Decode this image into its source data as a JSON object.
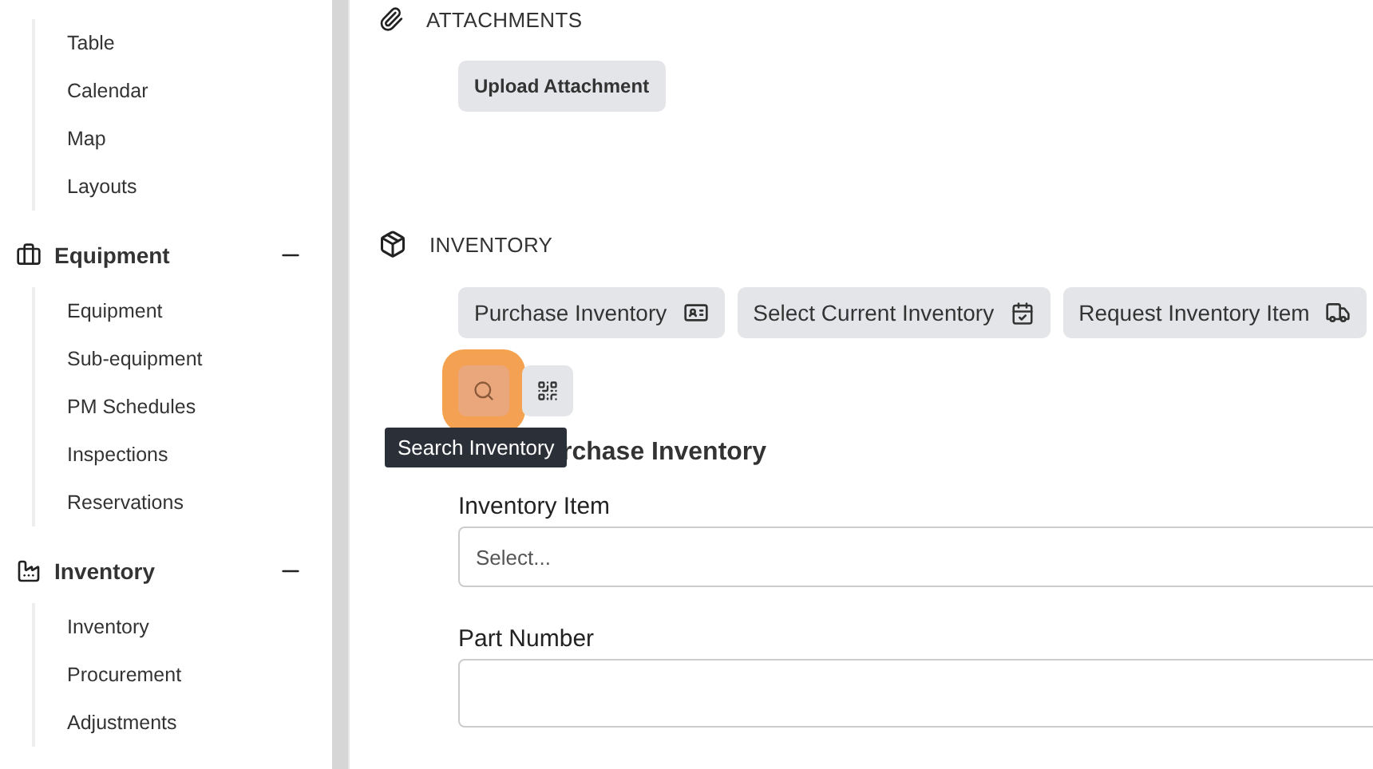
{
  "sidebar": {
    "sections": [
      {
        "items": [
          {
            "label": "Table"
          },
          {
            "label": "Calendar"
          },
          {
            "label": "Map"
          },
          {
            "label": "Layouts"
          }
        ]
      },
      {
        "title": "Equipment",
        "expanded": true,
        "items": [
          {
            "label": "Equipment"
          },
          {
            "label": "Sub-equipment"
          },
          {
            "label": "PM Schedules"
          },
          {
            "label": "Inspections"
          },
          {
            "label": "Reservations"
          }
        ]
      },
      {
        "title": "Inventory",
        "expanded": true,
        "items": [
          {
            "label": "Inventory"
          },
          {
            "label": "Procurement"
          },
          {
            "label": "Adjustments"
          }
        ]
      }
    ]
  },
  "attachments": {
    "title": "ATTACHMENTS",
    "buttons": [
      {
        "label": "Upload Attachment"
      }
    ]
  },
  "inventory": {
    "title": "INVENTORY",
    "buttons": [
      {
        "label": "Purchase Inventory",
        "kind": "card"
      },
      {
        "label": "Select Current Inventory",
        "kind": "calendar"
      },
      {
        "label": "Request Inventory Item",
        "kind": "truck"
      }
    ],
    "icon_buttons": [
      {
        "kind": "search",
        "selected": true
      },
      {
        "kind": "qr",
        "selected": false
      }
    ],
    "tooltip": "Search Inventory",
    "form": {
      "heading": "rchase Inventory",
      "fields": [
        {
          "label": "Inventory Item",
          "placeholder": "Select..."
        },
        {
          "label": "Part Number"
        }
      ]
    }
  }
}
